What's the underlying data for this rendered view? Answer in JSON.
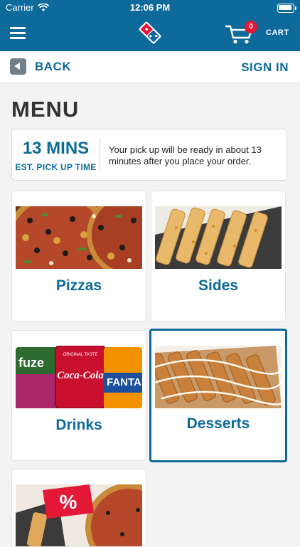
{
  "status_bar": {
    "carrier": "Carrier",
    "time": "12:06 PM"
  },
  "header": {
    "menu_icon": "hamburger-icon",
    "logo_icon": "dominos-logo",
    "cart_icon": "cart-icon",
    "cart_count": "0",
    "cart_label": "CART",
    "bar_color": "#0d6a9a"
  },
  "nav": {
    "back_label": "BACK",
    "signin_label": "SIGN IN"
  },
  "page": {
    "title": "MENU"
  },
  "pickup": {
    "time": "13 MINS",
    "label": "EST. PICK UP TIME",
    "message": "Your pick up will be ready in about 13 minutes after you place your order."
  },
  "categories": [
    {
      "label": "Pizzas",
      "selected": false
    },
    {
      "label": "Sides",
      "selected": false
    },
    {
      "label": "Drinks",
      "selected": false
    },
    {
      "label": "Desserts",
      "selected": true
    },
    {
      "label": "",
      "selected": false
    }
  ],
  "drinks_image_text": {
    "can1": "fuze",
    "bottle": "Coca-Cola",
    "bottle_top": "ORIGINAL TASTE",
    "can2": "FANTA"
  },
  "deals_image_text": {
    "tag": "%"
  },
  "colors": {
    "accent": "#0d6a9a",
    "badge": "#e31837"
  }
}
